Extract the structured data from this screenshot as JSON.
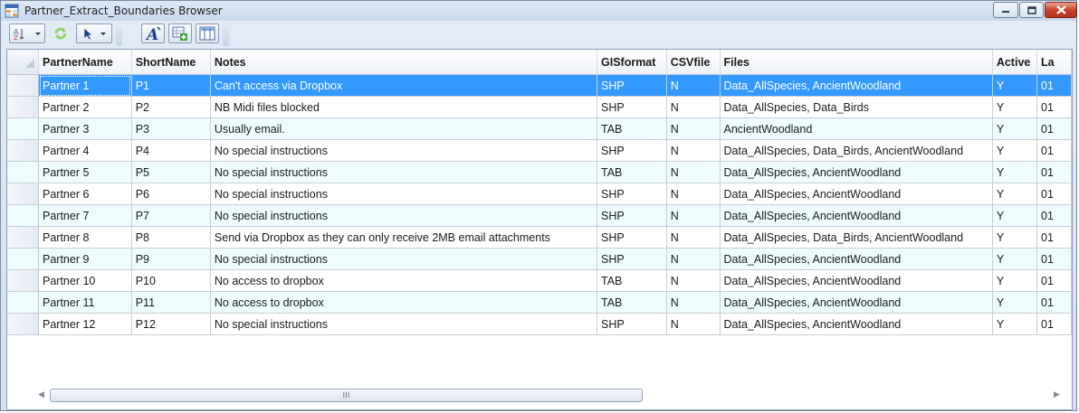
{
  "window": {
    "title": "Partner_Extract_Boundaries Browser"
  },
  "toolbar": {
    "buttons": [
      "filter-dropdown-icon",
      "refresh-icon",
      "select-dropdown-icon",
      "font-icon",
      "add-field-icon",
      "columns-icon"
    ]
  },
  "table": {
    "columns": [
      "PartnerName",
      "ShortName",
      "Notes",
      "GISformat",
      "CSVfile",
      "Files",
      "Active",
      "La"
    ],
    "selected_row": 0,
    "rows": [
      {
        "name": "Partner 1",
        "short": "P1",
        "notes": "Can't access via Dropbox",
        "gis": "SHP",
        "csv": "N",
        "files": "Data_AllSpecies, AncientWoodland",
        "active": "Y",
        "last": "01"
      },
      {
        "name": "Partner 2",
        "short": "P2",
        "notes": "NB Midi files blocked",
        "gis": "SHP",
        "csv": "N",
        "files": "Data_AllSpecies, Data_Birds",
        "active": "Y",
        "last": "01"
      },
      {
        "name": "Partner 3",
        "short": "P3",
        "notes": "Usually email.",
        "gis": "TAB",
        "csv": "N",
        "files": "AncientWoodland",
        "active": "Y",
        "last": "01"
      },
      {
        "name": "Partner 4",
        "short": "P4",
        "notes": "No special instructions",
        "gis": "SHP",
        "csv": "N",
        "files": "Data_AllSpecies, Data_Birds, AncientWoodland",
        "active": "Y",
        "last": "01"
      },
      {
        "name": "Partner 5",
        "short": "P5",
        "notes": "No special instructions",
        "gis": "TAB",
        "csv": "N",
        "files": "Data_AllSpecies, AncientWoodland",
        "active": "Y",
        "last": "01"
      },
      {
        "name": "Partner 6",
        "short": "P6",
        "notes": "No special instructions",
        "gis": "SHP",
        "csv": "N",
        "files": "Data_AllSpecies, AncientWoodland",
        "active": "Y",
        "last": "01"
      },
      {
        "name": "Partner 7",
        "short": "P7",
        "notes": "No special instructions",
        "gis": "SHP",
        "csv": "N",
        "files": "Data_AllSpecies, AncientWoodland",
        "active": "Y",
        "last": "01"
      },
      {
        "name": "Partner 8",
        "short": "P8",
        "notes": "Send via Dropbox as they can only receive 2MB email attachments",
        "gis": "SHP",
        "csv": "N",
        "files": "Data_AllSpecies, Data_Birds, AncientWoodland",
        "active": "Y",
        "last": "01"
      },
      {
        "name": "Partner 9",
        "short": "P9",
        "notes": "No special instructions",
        "gis": "SHP",
        "csv": "N",
        "files": "Data_AllSpecies, AncientWoodland",
        "active": "Y",
        "last": "01"
      },
      {
        "name": "Partner 10",
        "short": "P10",
        "notes": "No access to dropbox",
        "gis": "TAB",
        "csv": "N",
        "files": "Data_AllSpecies, AncientWoodland",
        "active": "Y",
        "last": "01"
      },
      {
        "name": "Partner 11",
        "short": "P11",
        "notes": "No access to dropbox",
        "gis": "TAB",
        "csv": "N",
        "files": "Data_AllSpecies, AncientWoodland",
        "active": "Y",
        "last": "01"
      },
      {
        "name": "Partner 12",
        "short": "P12",
        "notes": "No special instructions",
        "gis": "SHP",
        "csv": "N",
        "files": "Data_AllSpecies, AncientWoodland",
        "active": "Y",
        "last": "01"
      }
    ]
  },
  "scrollbar": {
    "thumb_label": "III"
  },
  "colors": {
    "selection": "#3399ff",
    "alt_row": "#eefcfd",
    "close_button": "#c8442b"
  }
}
